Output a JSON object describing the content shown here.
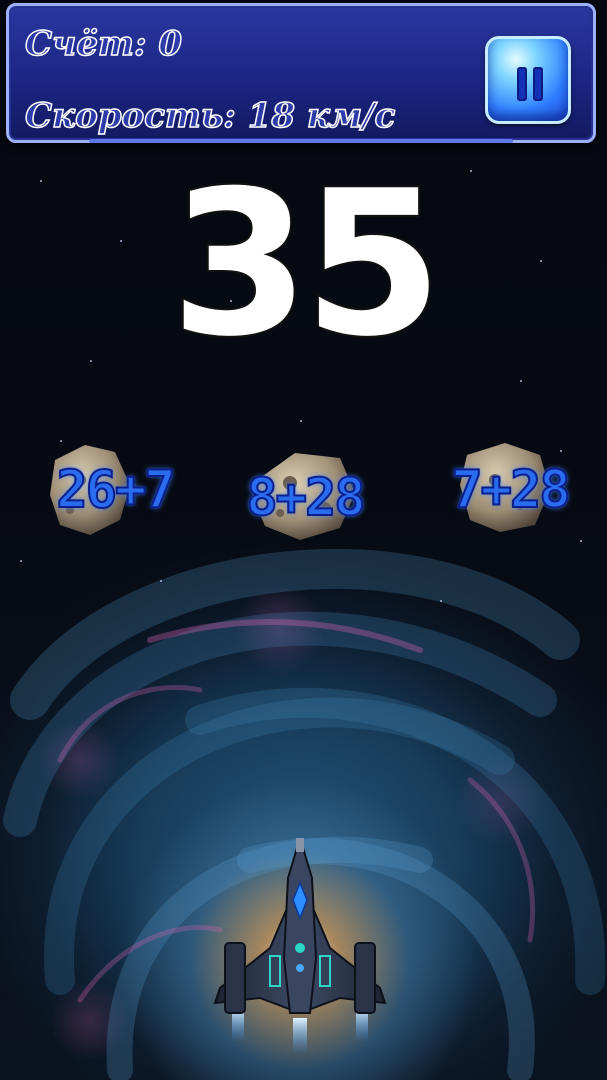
{
  "hud": {
    "score_label": "Счёт: 0",
    "speed_label": "Скорость: 18 км/с",
    "pause_icon": "pause-icon"
  },
  "target": {
    "value": "35"
  },
  "asteroids": [
    {
      "equation": "26+7"
    },
    {
      "equation": "8+28"
    },
    {
      "equation": "7+28"
    }
  ],
  "player": {
    "icon": "spaceship-icon"
  },
  "colors": {
    "hud_background": "#1f2a8c",
    "hud_border": "#9db1ff",
    "pause_button": "#2f7fff",
    "equation_text": "#2a6cf0",
    "target_text": "#ffffff"
  }
}
